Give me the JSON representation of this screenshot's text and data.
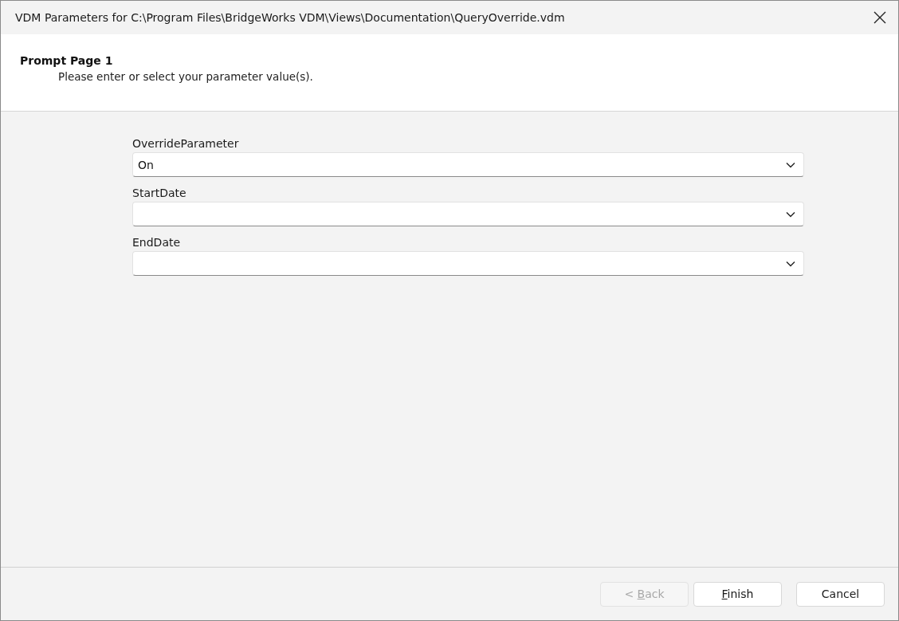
{
  "window": {
    "title": "VDM Parameters for C:\\Program Files\\BridgeWorks VDM\\Views\\Documentation\\QueryOverride.vdm"
  },
  "header": {
    "title": "Prompt Page 1",
    "subtitle": "Please enter or select your parameter value(s)."
  },
  "parameters": [
    {
      "label": "OverrideParameter",
      "value": "On"
    },
    {
      "label": "StartDate"
    },
    {
      "label": "EndDate"
    }
  ],
  "buttons": [
    {
      "text_before": "< ",
      "access_key": "B",
      "text_after": "ack",
      "disabled": true
    },
    {
      "access_key": "F",
      "text_after": "inish",
      "disabled": false
    },
    {
      "text_before": "Cancel",
      "disabled": false
    }
  ]
}
